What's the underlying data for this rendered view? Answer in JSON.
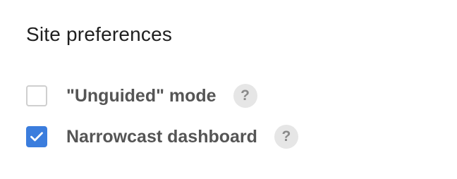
{
  "panel": {
    "title": "Site preferences"
  },
  "preferences": [
    {
      "label": "\"Unguided\" mode",
      "checked": false,
      "help_glyph": "?"
    },
    {
      "label": "Narrowcast dashboard",
      "checked": true,
      "help_glyph": "?"
    }
  ],
  "colors": {
    "accent": "#3b7ddd",
    "label": "#555555",
    "title": "#1f1f1f",
    "help_bg": "#e6e6e6"
  },
  "icons": {
    "checkbox_checked": "check-icon",
    "help": "help-icon"
  }
}
